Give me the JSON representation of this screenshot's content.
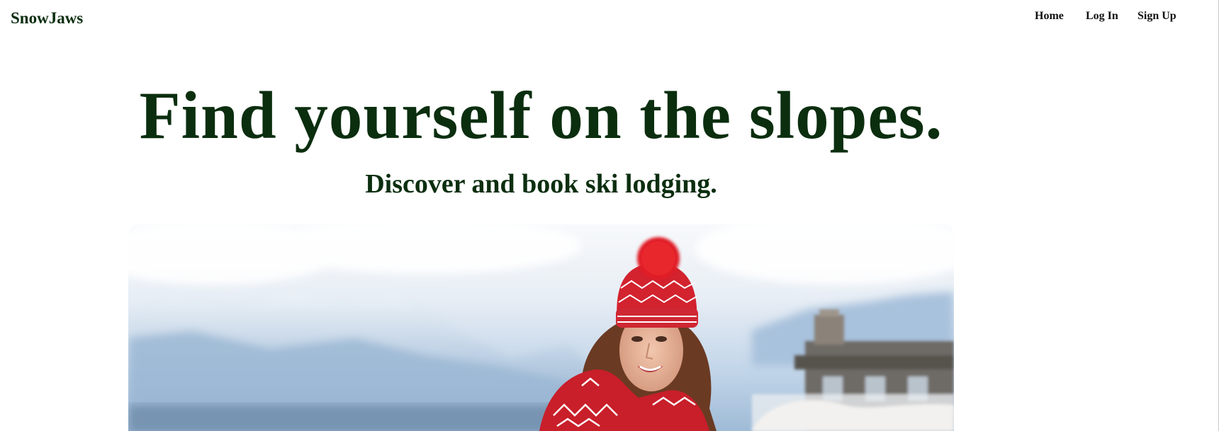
{
  "brand": {
    "name": "SnowJaws"
  },
  "nav": {
    "home": "Home",
    "login": "Log In",
    "signup": "Sign Up"
  },
  "hero": {
    "headline": "Find yourself on the slopes.",
    "subheadline": "Discover and book ski lodging."
  },
  "colors": {
    "brand_green": "#0b2e0f",
    "sky": "#a9c4de",
    "hat_red": "#d2232f"
  },
  "image": {
    "subject": "hero-photo-skier-woman-red-hat"
  }
}
